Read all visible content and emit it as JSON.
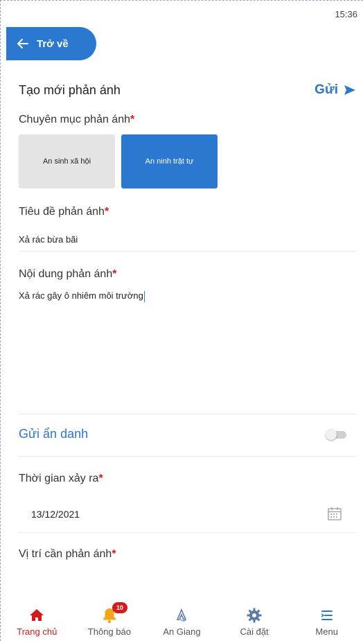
{
  "status_bar": {
    "time": "15:36"
  },
  "header": {
    "back_label": "Trở về",
    "title": "Tạo mới phản ánh",
    "send_label": "Gửi"
  },
  "form": {
    "category": {
      "label": "Chuyên mục phản ánh",
      "required_mark": "*",
      "options": [
        {
          "label": "An sinh xã hội",
          "selected": false
        },
        {
          "label": "An ninh trật tự",
          "selected": true
        }
      ]
    },
    "title_field": {
      "label": "Tiêu đề phản ánh",
      "required_mark": "*",
      "value": "Xả rác bừa bãi"
    },
    "content_field": {
      "label": "Nội dung phản ánh",
      "required_mark": "*",
      "value": "Xả rác gây ô nhiêm môi trường"
    },
    "anonymous": {
      "label": "Gửi ẩn danh",
      "enabled": false
    },
    "time_field": {
      "label": "Thời gian xảy ra",
      "required_mark": "*",
      "value": "13/12/2021"
    },
    "location_field": {
      "label": "Vị trí cần phản ánh",
      "required_mark": "*"
    }
  },
  "bottom_nav": {
    "items": [
      {
        "label": "Trang chủ",
        "icon": "home-icon",
        "active": true
      },
      {
        "label": "Thông báo",
        "icon": "bell-icon",
        "badge": "10"
      },
      {
        "label": "An Giang",
        "icon": "an-giang-logo-icon"
      },
      {
        "label": "Cài đặt",
        "icon": "gear-icon"
      },
      {
        "label": "Menu",
        "icon": "menu-icon"
      }
    ]
  },
  "colors": {
    "primary": "#2a78d0",
    "required": "#d41a1a",
    "inactive_chip": "#e4e4e4",
    "badge": "#d41a1a"
  }
}
